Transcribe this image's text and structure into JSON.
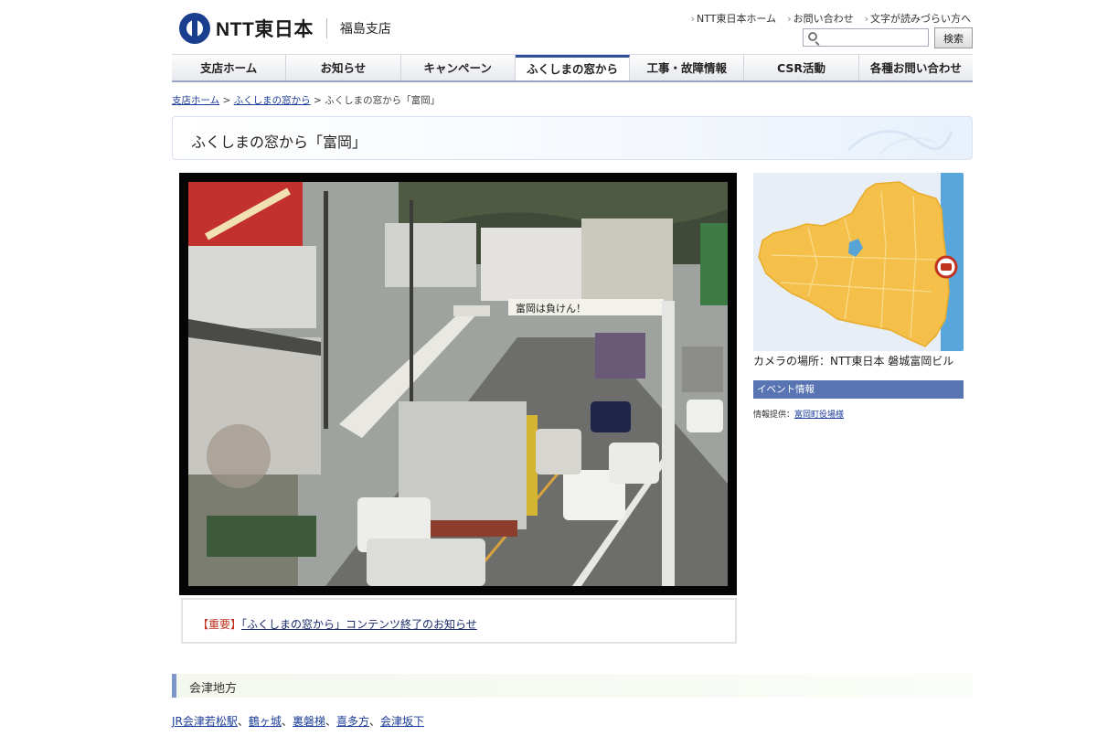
{
  "header": {
    "brand": "NTT東日本",
    "branch": "福島支店",
    "util_links": [
      "NTT東日本ホーム",
      "お問い合わせ",
      "文字が読みづらい方へ"
    ],
    "search_placeholder": "",
    "search_button": "検索"
  },
  "nav": {
    "tabs": [
      "支店ホーム",
      "お知らせ",
      "キャンペーン",
      "ふくしまの窓から",
      "工事・故障情報",
      "CSR活動",
      "各種お問い合わせ"
    ],
    "active_index": 3
  },
  "breadcrumb": {
    "items": [
      "支店ホーム",
      "ふくしまの窓から"
    ],
    "current": "ふくしまの窓から「富岡」",
    "sep": " > "
  },
  "page": {
    "title": "ふくしまの窓から「富岡」"
  },
  "camera": {
    "banner_text": "富岡は負けん！"
  },
  "notice": {
    "tag": "【重要】",
    "link": "「ふくしまの窓から」コンテンツ終了のお知らせ"
  },
  "side": {
    "camera_location": "カメラの場所：NTT東日本 磐城富岡ビル",
    "event_heading": "イベント情報",
    "source_label": "情報提供：",
    "source_link": "富岡町役場様"
  },
  "region": {
    "heading": "会津地方",
    "links": [
      "JR会津若松駅",
      "鶴ヶ城",
      "裏磐梯",
      "喜多方",
      "会津坂下"
    ],
    "sep": "、"
  },
  "colors": {
    "nav_accent": "#2f4f9a",
    "map_fill": "#f4c04a",
    "event_bar": "#5874b3",
    "important": "#c0321e"
  }
}
